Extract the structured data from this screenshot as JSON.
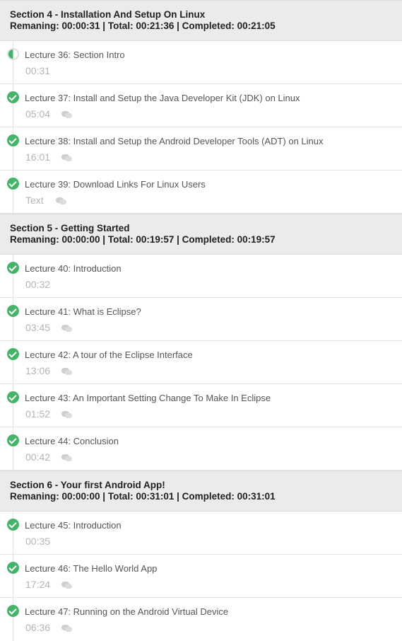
{
  "sections": [
    {
      "title": "Section 4 - Installation And Setup On Linux",
      "stats": "Remaning: 00:00:31 | Total: 00:21:36 | Completed: 00:21:05",
      "lectures": [
        {
          "title": "Lecture 36: Section Intro",
          "meta": "00:31",
          "status": "in-progress",
          "comments": false
        },
        {
          "title": "Lecture 37: Install and Setup the Java Developer Kit (JDK) on Linux",
          "meta": "05:04",
          "status": "completed",
          "comments": true
        },
        {
          "title": "Lecture 38: Install and Setup the Android Developer Tools (ADT) on Linux",
          "meta": "16:01",
          "status": "completed",
          "comments": true
        },
        {
          "title": "Lecture 39: Download Links For Linux Users",
          "meta": "Text",
          "status": "completed",
          "comments": true
        }
      ]
    },
    {
      "title": "Section 5 - Getting Started",
      "stats": "Remaning: 00:00:00 | Total: 00:19:57 | Completed: 00:19:57",
      "lectures": [
        {
          "title": "Lecture 40: Introduction",
          "meta": "00:32",
          "status": "completed",
          "comments": false
        },
        {
          "title": "Lecture 41: What is Eclipse?",
          "meta": "03:45",
          "status": "completed",
          "comments": true
        },
        {
          "title": "Lecture 42: A tour of the Eclipse Interface",
          "meta": "13:06",
          "status": "completed",
          "comments": true
        },
        {
          "title": "Lecture 43: An Important Setting Change To Make In Eclipse",
          "meta": "01:52",
          "status": "completed",
          "comments": true
        },
        {
          "title": "Lecture 44: Conclusion",
          "meta": "00:42",
          "status": "completed",
          "comments": true
        }
      ]
    },
    {
      "title": "Section 6 - Your first Android App!",
      "stats": "Remaning: 00:00:00 | Total: 00:31:01 | Completed: 00:31:01",
      "lectures": [
        {
          "title": "Lecture 45: Introduction",
          "meta": "00:35",
          "status": "completed",
          "comments": false
        },
        {
          "title": "Lecture 46: The Hello World App",
          "meta": "17:24",
          "status": "completed",
          "comments": true
        },
        {
          "title": "Lecture 47: Running on the Android Virtual Device",
          "meta": "06:36",
          "status": "completed",
          "comments": true
        }
      ]
    }
  ],
  "colors": {
    "completed": "#45b36a",
    "header_bg": "#ebebeb",
    "meta_text": "#b4b4b4"
  }
}
